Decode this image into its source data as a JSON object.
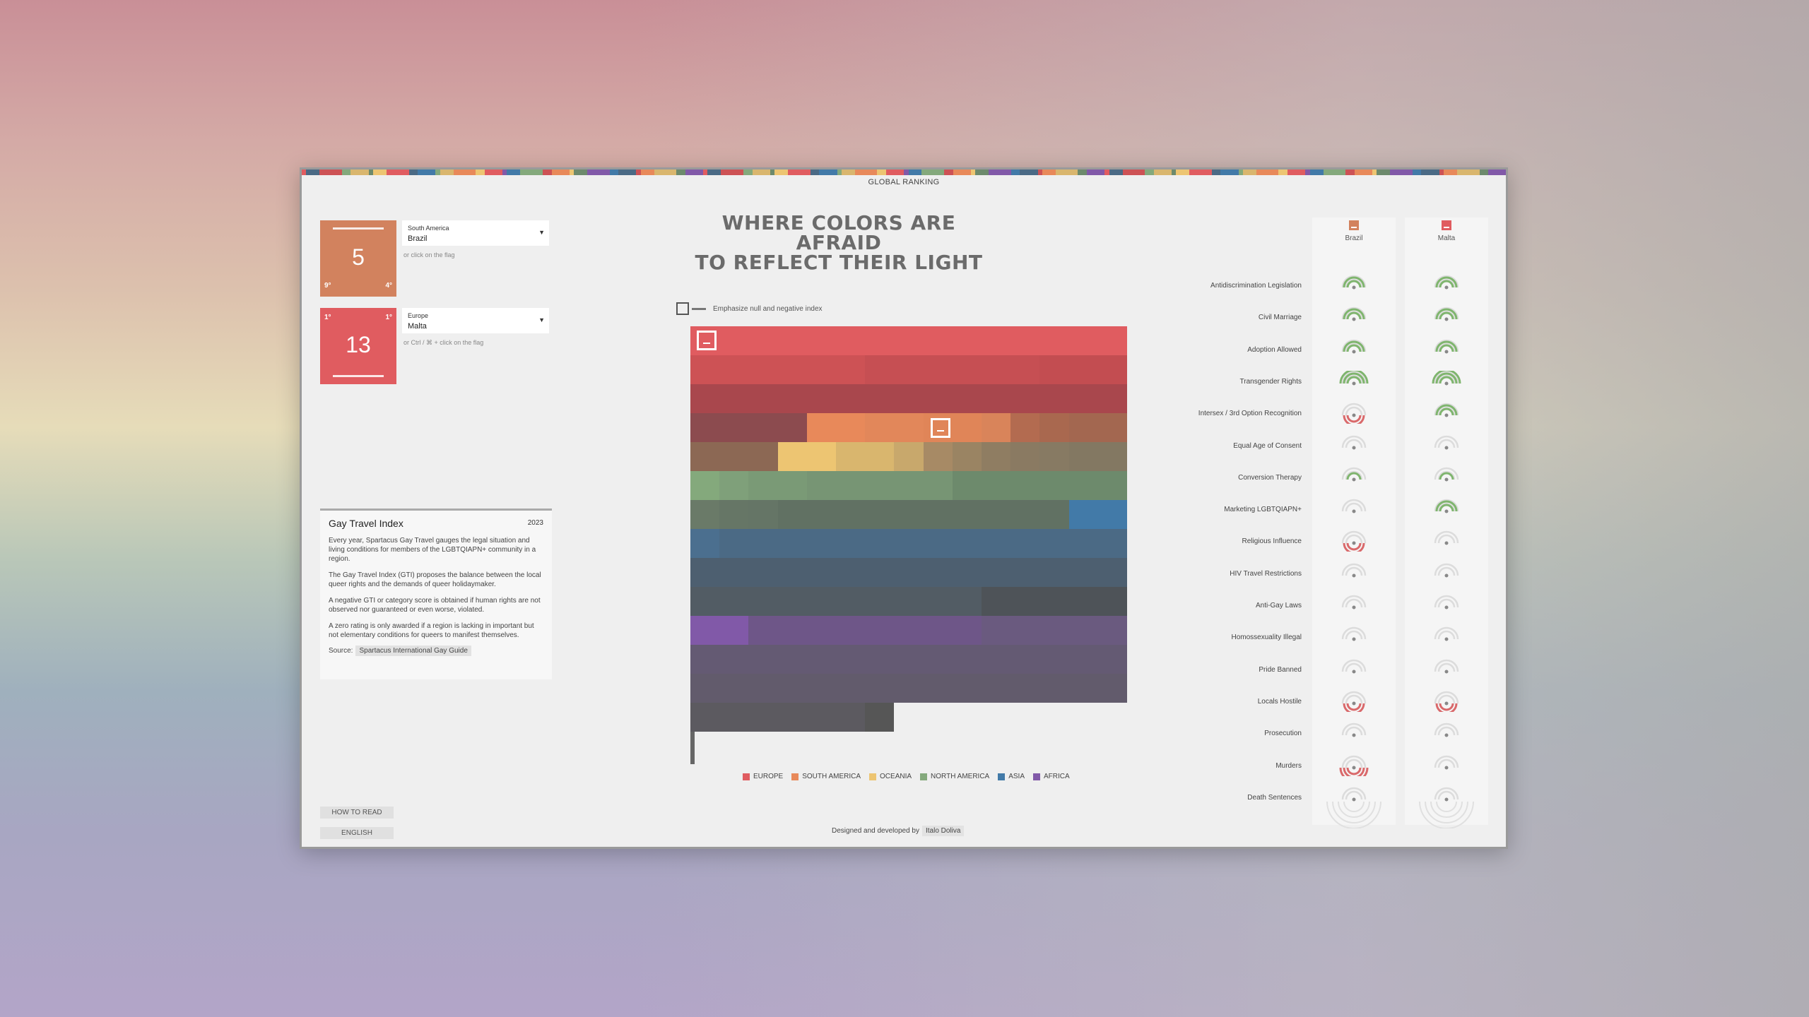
{
  "page": {
    "nav_label": "GLOBAL RANKING",
    "title_line1": "WHERE COLORS ARE AFRAID",
    "title_line2": "TO REFLECT THEIR LIGHT"
  },
  "selection_a": {
    "rank": "5",
    "corner_left": "9°",
    "corner_right": "4°",
    "region": "South America",
    "country": "Brazil",
    "hint": "or click on the flag",
    "color": "#d2825e"
  },
  "selection_b": {
    "rank": "13",
    "corner_left": "1°",
    "corner_right": "1°",
    "region": "Europe",
    "country": "Malta",
    "hint": "or Ctrl / ⌘ + click on the flag",
    "color": "#e05c60"
  },
  "info": {
    "title": "Gay Travel Index",
    "year": "2023",
    "p1": "Every year, Spartacus Gay Travel gauges the legal situation and living conditions for members of the LGBTQIAPN+ community in a region.",
    "p2": "The Gay Travel Index (GTI) proposes the balance between the local queer rights and the demands of queer holidaymaker.",
    "p3": "A negative GTI or category score is obtained if human rights are not observed nor guaranteed or even worse, violated.",
    "p4": "A zero rating is only awarded if a region is lacking in important but not elementary conditions for queers to manifest themselves.",
    "source_label": "Source:",
    "source_link": "Spartacus International Gay Guide"
  },
  "buttons": {
    "how_to_read": "HOW TO READ",
    "language": "ENGLISH"
  },
  "toggle": {
    "label": "Emphasize null and negative index"
  },
  "legend": [
    {
      "label": "EUROPE",
      "color": "#e05c60"
    },
    {
      "label": "SOUTH AMERICA",
      "color": "#e8895a"
    },
    {
      "label": "OCEANIA",
      "color": "#edc572"
    },
    {
      "label": "NORTH AMERICA",
      "color": "#84a97c"
    },
    {
      "label": "ASIA",
      "color": "#427aa8"
    },
    {
      "label": "AFRICA",
      "color": "#8159a8"
    }
  ],
  "credit": {
    "text": "Designed and developed by",
    "author": "Italo Doliva"
  },
  "compare": {
    "country_a": "Brazil",
    "country_b": "Malta",
    "categories": [
      "Antidiscrimination Legislation",
      "Civil Marriage",
      "Adoption Allowed",
      "Transgender Rights",
      "Intersex / 3rd Option Recognition",
      "Equal Age of Consent",
      "Conversion Therapy",
      "Marketing LGBTQIAPN+",
      "Religious Influence",
      "HIV Travel Restrictions",
      "Anti-Gay Laws",
      "Homossexuality Illegal",
      "Pride Banned",
      "Locals Hostile",
      "Prosecution",
      "Murders",
      "Death Sentences"
    ],
    "scores_a": [
      2,
      2,
      2,
      3,
      -2,
      0,
      1,
      0,
      -2,
      0,
      0,
      0,
      0,
      -2,
      0,
      -3,
      0
    ],
    "scores_b": [
      2,
      2,
      2,
      3,
      2,
      0,
      1,
      2,
      0,
      0,
      0,
      0,
      0,
      -2,
      0,
      0,
      0
    ]
  },
  "grid_rows": [
    [
      "#e05c60",
      "#e05c60",
      "#e05c60",
      "#e05c60",
      "#e05c60",
      "#e05c60",
      "#e05c60",
      "#e05c60",
      "#e05c60",
      "#e05c60",
      "#e05c60",
      "#e05c60",
      "#e05c60",
      "#e05c60",
      "#e05c60"
    ],
    [
      "#cd5255",
      "#cd5255",
      "#cd5255",
      "#cd5255",
      "#cd5255",
      "#cd5255",
      "#c64f53",
      "#c64f53",
      "#c64f53",
      "#c64f53",
      "#c64f53",
      "#c64f53",
      "#c34d51",
      "#c34d51",
      "#c34d51"
    ],
    [
      "#a9474d",
      "#a9474d",
      "#a9474d",
      "#a9474d",
      "#a9474d",
      "#a9474d",
      "#a9474d",
      "#a9474d",
      "#a9474d",
      "#a9474d",
      "#a9474d",
      "#a9474d",
      "#a9474d",
      "#a9474d",
      "#a9474d"
    ],
    [
      "#8c4b4f",
      "#8c4b4f",
      "#8c4b4f",
      "#8c4b4f",
      "#e8895a",
      "#e8895a",
      "#e2875a",
      "#e2875a",
      "#e08558",
      "#e08558",
      "#d9845a",
      "#b36b50",
      "#a9684f",
      "#a36750",
      "#a36750"
    ],
    [
      "#8c6854",
      "#8c6854",
      "#8c6854",
      "#edc572",
      "#edc572",
      "#d9b66e",
      "#d9b66e",
      "#c8a86c",
      "#a78a65",
      "#9a8463",
      "#8f7d62",
      "#8a7a62",
      "#877a63",
      "#837862",
      "#837862"
    ],
    [
      "#84a97c",
      "#7fa07a",
      "#7a9a76",
      "#7a9a76",
      "#779574",
      "#779574",
      "#779574",
      "#779574",
      "#779574",
      "#6d8a6c",
      "#6d8a6c",
      "#6d8a6c",
      "#6d8a6c",
      "#6d8a6c",
      "#6d8a6c"
    ],
    [
      "#6a7a68",
      "#667666",
      "#657566",
      "#617163",
      "#617163",
      "#617163",
      "#617163",
      "#617163",
      "#617163",
      "#617163",
      "#617163",
      "#617163",
      "#617163",
      "#427aa8",
      "#427aa8"
    ],
    [
      "#4b6f8f",
      "#4b6a85",
      "#4b6a85",
      "#4b6a85",
      "#4b6a85",
      "#4b6a85",
      "#4b6a85",
      "#4b6a85",
      "#4b6a85",
      "#4b6a85",
      "#4b6a85",
      "#4b6a85",
      "#4b6a85",
      "#4b6a85",
      "#4b6a85"
    ],
    [
      "#4d5f70",
      "#4d5f70",
      "#4d5f70",
      "#4d5f70",
      "#4d5f70",
      "#4d5f70",
      "#4d5f70",
      "#4d5f70",
      "#4d5f70",
      "#4d5f70",
      "#4d5f70",
      "#4d5f70",
      "#4d5f70",
      "#4d5f70",
      "#4d5f70"
    ],
    [
      "#525c64",
      "#525c64",
      "#525c64",
      "#525c64",
      "#525c64",
      "#525c64",
      "#525c64",
      "#525c64",
      "#525c64",
      "#525c64",
      "#4e5358",
      "#4e5358",
      "#4e5358",
      "#4e5358",
      "#4e5358"
    ],
    [
      "#8159a8",
      "#8159a8",
      "#6e5688",
      "#6e5688",
      "#6e5688",
      "#6e5688",
      "#6e5688",
      "#6e5688",
      "#6e5688",
      "#6e5688",
      "#6a5a7f",
      "#6a5a7f",
      "#6a5a7f",
      "#6a5a7f",
      "#6a5a7f"
    ],
    [
      "#645a73",
      "#645a73",
      "#645a73",
      "#645a73",
      "#645a73",
      "#645a73",
      "#645a73",
      "#645a73",
      "#645a73",
      "#645a73",
      "#645a73",
      "#645a73",
      "#645a73",
      "#645a73",
      "#645a73"
    ],
    [
      "#625b6c",
      "#625b6c",
      "#625b6c",
      "#625b6c",
      "#625b6c",
      "#625b6c",
      "#625b6c",
      "#625b6c",
      "#625b6c",
      "#625b6c",
      "#625b6c",
      "#625b6c",
      "#625b6c",
      "#625b6c",
      "#625b6c"
    ],
    [
      "#5c5a60",
      "#5c5a60",
      "#5c5a60",
      "#5c5a60",
      "#5c5a60",
      "#5c5a60",
      "#565656",
      "",
      "",
      "",
      "",
      "",
      "",
      "",
      ""
    ]
  ],
  "stripe_colors": [
    "#e05c60",
    "#84a97c",
    "#edc572",
    "#427aa8",
    "#e8895a",
    "#8159a8",
    "#cd5255",
    "#6d8a6c",
    "#4b6a85",
    "#d9b66e"
  ]
}
